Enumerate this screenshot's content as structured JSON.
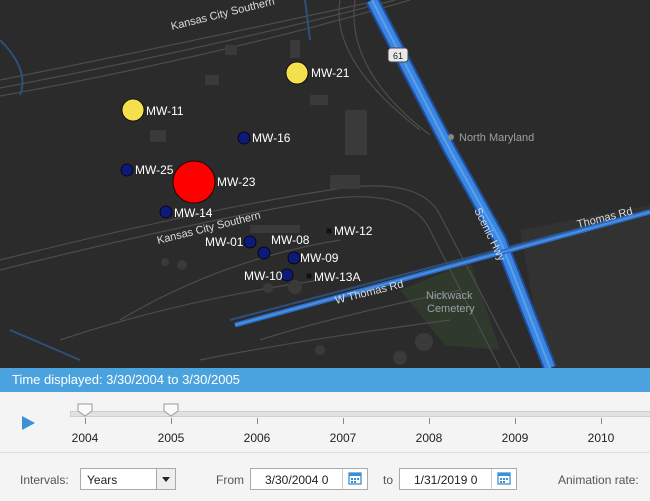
{
  "map": {
    "places": {
      "north_maryland": "North Maryland",
      "cemetery_line1": "Nickwack",
      "cemetery_line2": "Cemetery"
    },
    "roads": {
      "kansas_city_southern_top": "Kansas City Southern",
      "kansas_city_southern_mid": "Kansas City Southern",
      "scenic_hwy": "Scenic Hwy",
      "thomas_rd": "Thomas Rd",
      "w_thomas_rd": "W Thomas Rd",
      "route_shield": "61"
    },
    "wells": [
      {
        "id": "MW-21",
        "color": "#f4e04d"
      },
      {
        "id": "MW-11",
        "color": "#f4e04d"
      },
      {
        "id": "MW-16",
        "color": "#0d1a7a"
      },
      {
        "id": "MW-25",
        "color": "#0d1a7a"
      },
      {
        "id": "MW-23",
        "color": "#ff0000"
      },
      {
        "id": "MW-14",
        "color": "#0d1a7a"
      },
      {
        "id": "MW-12",
        "color": "#111111"
      },
      {
        "id": "MW-01",
        "color": "#0d1a7a"
      },
      {
        "id": "MW-08",
        "color": "#0d1a7a"
      },
      {
        "id": "MW-09",
        "color": "#0d1a7a"
      },
      {
        "id": "MW-10",
        "color": "#0d1a7a"
      },
      {
        "id": "MW-13A",
        "color": "#111111"
      }
    ]
  },
  "time_bar": {
    "text": "Time displayed: 3/30/2004 to 3/30/2005"
  },
  "timeline": {
    "years": [
      "2004",
      "2005",
      "2006",
      "2007",
      "2008",
      "2009",
      "2010"
    ]
  },
  "controls": {
    "intervals_label": "Intervals:",
    "interval_value": "Years",
    "from_label": "From",
    "from_value": "3/30/2004 0",
    "to_label": "to",
    "to_value": "1/31/2019 0",
    "animation_rate_label": "Animation rate:"
  }
}
